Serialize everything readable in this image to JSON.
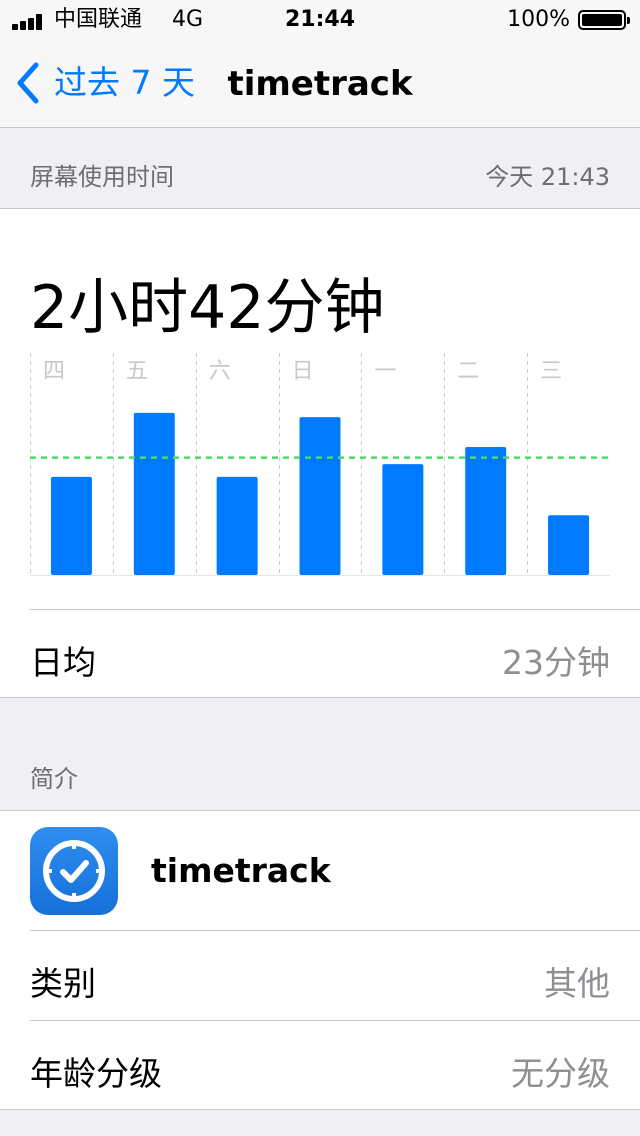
{
  "status_bar": {
    "carrier": "中国联通",
    "network": "4G",
    "time": "21:44",
    "battery": "100%"
  },
  "nav": {
    "back_label": "过去 7 天",
    "title": "timetrack"
  },
  "usage_section": {
    "header": "屏幕使用时间",
    "updated": "今天 21:43"
  },
  "usage": {
    "total": "2小时42分钟",
    "average_label": "日均",
    "average_value": "23分钟"
  },
  "chart_data": {
    "type": "bar",
    "categories": [
      "四",
      "五",
      "六",
      "日",
      "一",
      "二",
      "三"
    ],
    "values": [
      23,
      38,
      23,
      37,
      26,
      30,
      14
    ],
    "average": 27.5,
    "ylim": [
      0,
      45
    ],
    "bar_color": "#007aff",
    "average_line_color": "#4cd964"
  },
  "info_section": {
    "header": "简介"
  },
  "app": {
    "name": "timetrack",
    "icon": "clock-check-icon",
    "category_label": "类别",
    "category_value": "其他",
    "age_label": "年龄分级",
    "age_value": "无分级"
  },
  "colors": {
    "accent": "#007aff",
    "secondary_text": "#8e8e93",
    "grouped_background": "#efeff4"
  }
}
